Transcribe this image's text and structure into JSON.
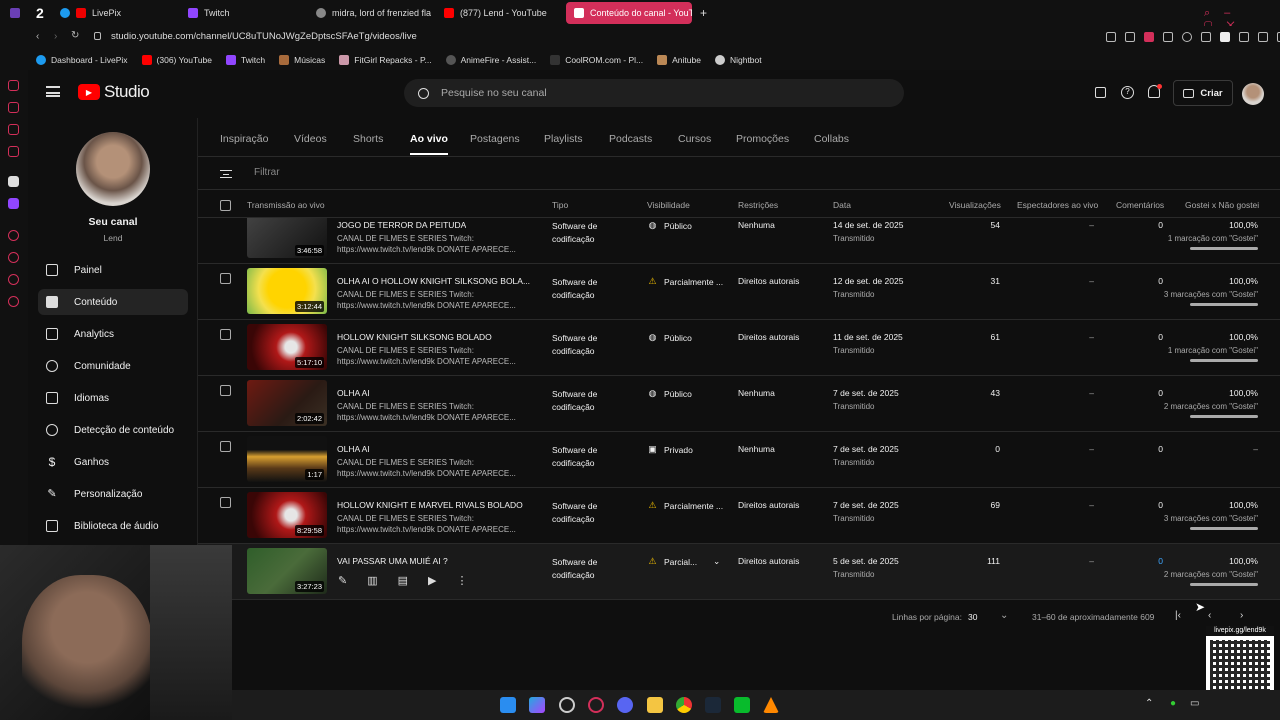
{
  "browser": {
    "tabs": [
      {
        "label": "LivePix",
        "active": false
      },
      {
        "label": "Twitch",
        "active": false
      },
      {
        "label": "midra, lord of frenzied fla",
        "active": false
      },
      {
        "label": "(877) Lend - YouTube",
        "active": false
      },
      {
        "label": "Conteúdo do canal - YouT",
        "active": true
      }
    ],
    "url": "studio.youtube.com/channel/UC8uTUNoJWgZeDptscSFAeTg/videos/live",
    "bookmarks": [
      "Dashboard - LivePix",
      "(306) YouTube",
      "Twitch",
      "Músicas",
      "FitGirl Repacks - P...",
      "AnimeFire - Assist...",
      "CoolROM.com - Pl...",
      "Anitube",
      "Nightbot"
    ]
  },
  "studio": {
    "logo_text": "Studio",
    "search_placeholder": "Pesquise no seu canal",
    "create_label": "Criar"
  },
  "channel": {
    "label": "Seu canal",
    "name": "Lend"
  },
  "nav": [
    {
      "label": "Painel",
      "icon": "dashboard-icon"
    },
    {
      "label": "Conteúdo",
      "icon": "content-icon",
      "active": true
    },
    {
      "label": "Analytics",
      "icon": "analytics-icon"
    },
    {
      "label": "Comunidade",
      "icon": "community-icon"
    },
    {
      "label": "Idiomas",
      "icon": "subtitles-icon"
    },
    {
      "label": "Detecção de conteúdo",
      "icon": "copyright-icon"
    },
    {
      "label": "Ganhos",
      "icon": "earn-icon"
    },
    {
      "label": "Personalização",
      "icon": "customization-icon"
    },
    {
      "label": "Biblioteca de áudio",
      "icon": "audio-library-icon"
    }
  ],
  "content_tabs": [
    "Inspiração",
    "Vídeos",
    "Shorts",
    "Ao vivo",
    "Postagens",
    "Playlists",
    "Podcasts",
    "Cursos",
    "Promoções",
    "Collabs"
  ],
  "filter_placeholder": "Filtrar",
  "columns": [
    "Transmissão ao vivo",
    "Tipo",
    "Visibilidade",
    "Restrições",
    "Data",
    "Visualizações",
    "Espectadores ao vivo",
    "Comentários",
    "Gostei x Não gostei"
  ],
  "rows": [
    {
      "title": "JOGO DE TERROR DA PEITUDA",
      "desc": "CANAL DE FILMES E SERIES Twitch: https://www.twitch.tv/lend9k DONATE APARECE...",
      "duration": "3:46:58",
      "type": "Software de codificação",
      "visibility": "Público",
      "restriction": "Nenhuma",
      "date": "14 de set. de 2025",
      "date_sub": "Transmitido",
      "views": "54",
      "live": "–",
      "comments": "0",
      "likes": "100,0%",
      "likes_sub": "1 marcação com \"Gostei\""
    },
    {
      "title": "OLHA AI O HOLLOW KNIGHT SILKSONG BOLA...",
      "desc": "CANAL DE FILMES E SERIES Twitch: https://www.twitch.tv/lend9k DONATE APARECE...",
      "duration": "3:12:44",
      "type": "Software de codificação",
      "visibility": "Parcialmente ...",
      "restriction": "Direitos autorais",
      "date": "12 de set. de 2025",
      "date_sub": "Transmitido",
      "views": "31",
      "live": "–",
      "comments": "0",
      "likes": "100,0%",
      "likes_sub": "3 marcações com \"Gostei\""
    },
    {
      "title": "HOLLOW KNIGHT SILKSONG BOLADO",
      "desc": "CANAL DE FILMES E SERIES Twitch: https://www.twitch.tv/lend9k DONATE APARECE...",
      "duration": "5:17:10",
      "type": "Software de codificação",
      "visibility": "Público",
      "restriction": "Direitos autorais",
      "date": "11 de set. de 2025",
      "date_sub": "Transmitido",
      "views": "61",
      "live": "–",
      "comments": "0",
      "likes": "100,0%",
      "likes_sub": "1 marcação com \"Gostei\""
    },
    {
      "title": "OLHA AI",
      "desc": "CANAL DE FILMES E SERIES Twitch: https://www.twitch.tv/lend9k DONATE APARECE...",
      "duration": "2:02:42",
      "type": "Software de codificação",
      "visibility": "Público",
      "restriction": "Nenhuma",
      "date": "7 de set. de 2025",
      "date_sub": "Transmitido",
      "views": "43",
      "live": "–",
      "comments": "0",
      "likes": "100,0%",
      "likes_sub": "2 marcações com \"Gostei\""
    },
    {
      "title": "OLHA AI",
      "desc": "CANAL DE FILMES E SERIES Twitch: https://www.twitch.tv/lend9k DONATE APARECE...",
      "duration": "1:17",
      "type": "Software de codificação",
      "visibility": "Privado",
      "restriction": "Nenhuma",
      "date": "7 de set. de 2025",
      "date_sub": "Transmitido",
      "views": "0",
      "live": "–",
      "comments": "0",
      "likes": "–",
      "likes_sub": ""
    },
    {
      "title": "HOLLOW KNIGHT E MARVEL RIVALS BOLADO",
      "desc": "CANAL DE FILMES E SERIES Twitch: https://www.twitch.tv/lend9k DONATE APARECE...",
      "duration": "8:29:58",
      "type": "Software de codificação",
      "visibility": "Parcialmente ...",
      "restriction": "Direitos autorais",
      "date": "7 de set. de 2025",
      "date_sub": "Transmitido",
      "views": "69",
      "live": "–",
      "comments": "0",
      "likes": "100,0%",
      "likes_sub": "3 marcações com \"Gostei\""
    },
    {
      "title": "VAI PASSAR UMA MUIÉ AI ?",
      "desc": "",
      "duration": "3:27:23",
      "type": "Software de codificação",
      "visibility": "Parcial...",
      "restriction": "Direitos autorais",
      "date": "5 de set. de 2025",
      "date_sub": "Transmitido",
      "views": "111",
      "live": "–",
      "comments": "0",
      "likes": "100,0%",
      "likes_sub": "2 marcações com \"Gostei\""
    }
  ],
  "pagination": {
    "rows_label": "Linhas por página:",
    "rows_value": "30",
    "range": "31–60 de aproximadamente 609"
  },
  "qr_caption": "livepix.gg/lend9k"
}
